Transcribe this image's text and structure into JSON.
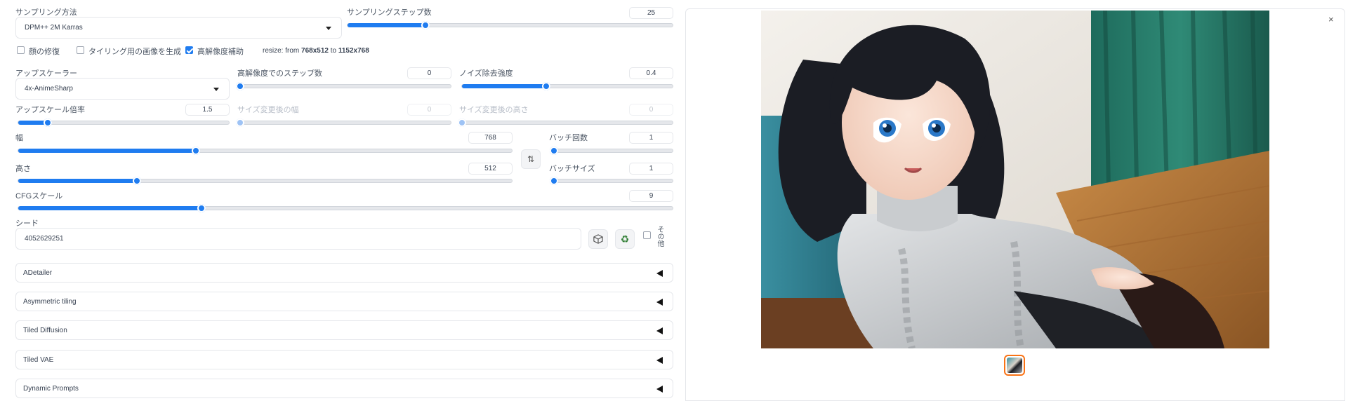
{
  "sampling": {
    "method_label": "サンプリング方法",
    "method_value": "DPM++ 2M Karras",
    "steps_label": "サンプリングステップ数",
    "steps_value": "25",
    "steps_fraction": 0.24
  },
  "checks": {
    "face_restore": "顔の修復",
    "tiling": "タイリング用の画像を生成",
    "hires_fix": "高解像度補助",
    "face_restore_on": false,
    "tiling_on": false,
    "hires_fix_on": true
  },
  "resize_info": {
    "prefix": "resize: from ",
    "from": "768x512",
    "mid": " to ",
    "to": "1152x768"
  },
  "hires": {
    "upscaler_label": "アップスケーラー",
    "upscaler_value": "4x-AnimeSharp",
    "steps_label": "高解像度でのステップ数",
    "steps_value": "0",
    "steps_fraction": 0.0,
    "denoise_label": "ノイズ除去強度",
    "denoise_value": "0.4",
    "denoise_fraction": 0.4,
    "scale_label": "アップスケール倍率",
    "scale_value": "1.5",
    "scale_fraction": 0.14,
    "resize_w_label": "サイズ変更後の幅",
    "resize_w_value": "0",
    "resize_h_label": "サイズ変更後の高さ",
    "resize_h_value": "0"
  },
  "size": {
    "width_label": "幅",
    "width_value": "768",
    "width_fraction": 0.36,
    "height_label": "高さ",
    "height_value": "512",
    "height_fraction": 0.24
  },
  "batch": {
    "count_label": "バッチ回数",
    "count_value": "1",
    "count_fraction": 0.0,
    "size_label": "バッチサイズ",
    "size_value": "1",
    "size_fraction": 0.0
  },
  "cfg": {
    "label": "CFGスケール",
    "value": "9",
    "fraction": 0.28
  },
  "seed": {
    "label": "シード",
    "value": "4052629251",
    "extra_label": "その他"
  },
  "accordions": [
    "ADetailer",
    "Asymmetric tiling",
    "Tiled Diffusion",
    "Tiled VAE",
    "Dynamic Prompts"
  ],
  "output": {
    "close_glyph": "×"
  },
  "colors": {
    "accent": "#1f7cf0",
    "thumb_border": "#f97316"
  }
}
